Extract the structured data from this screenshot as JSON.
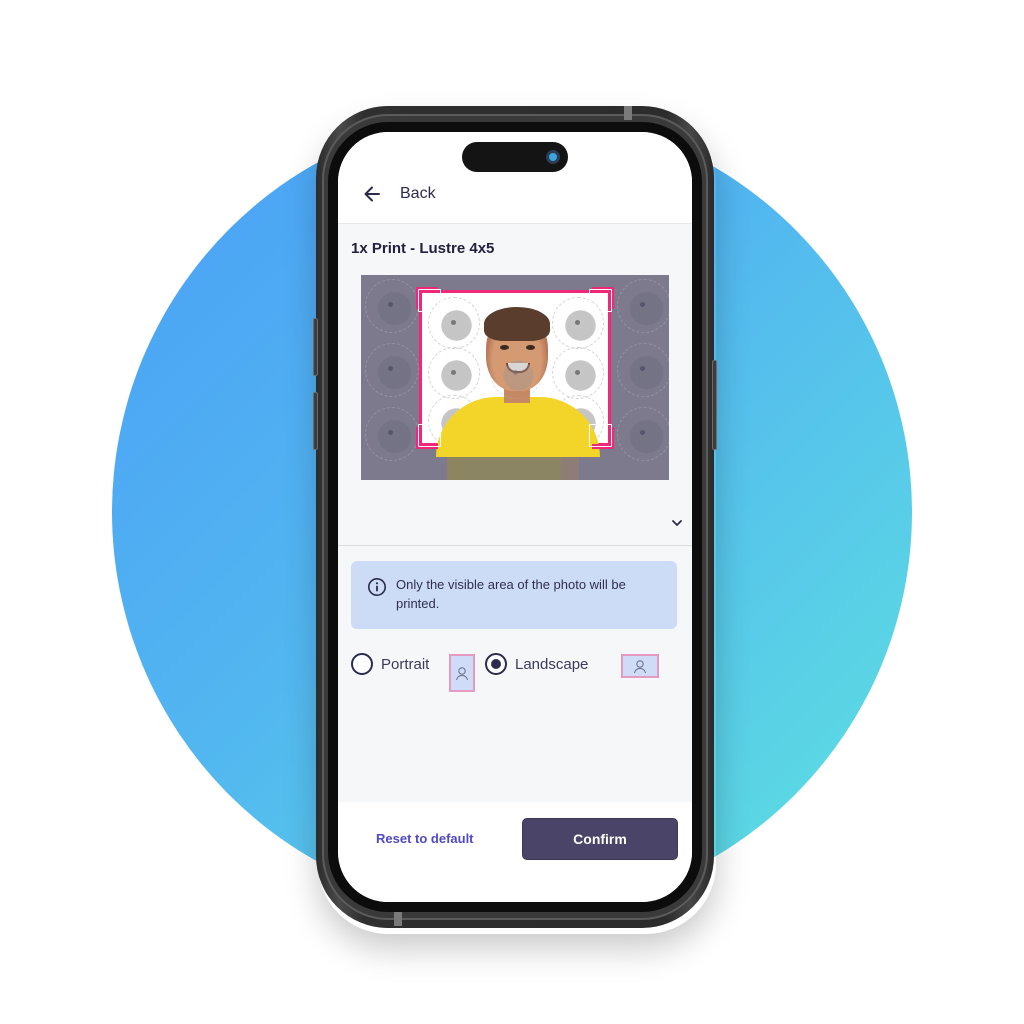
{
  "colors": {
    "background_gradient_start": "#4a9ff7",
    "background_gradient_end": "#5ee2e0",
    "crop_frame": "#f0287a",
    "info_box": "#cddcf6",
    "primary_button": "#4b4469",
    "link": "#5049c4",
    "text_dark": "#21213f"
  },
  "header": {
    "back_icon": "arrow-left-icon",
    "back_label": "Back"
  },
  "product": {
    "title": "1x Print - Lustre 4x5"
  },
  "preview": {
    "expand_icon": "chevron-down-icon",
    "crop_handles": [
      "top-left",
      "top-right",
      "bottom-left",
      "bottom-right"
    ]
  },
  "notice": {
    "icon": "info-icon",
    "text": "Only the visible area of the photo will be printed."
  },
  "orientation": {
    "options": [
      {
        "label": "Portrait",
        "selected": false,
        "icon": "portrait-thumbnail-icon"
      },
      {
        "label": "Landscape",
        "selected": true,
        "icon": "landscape-thumbnail-icon"
      }
    ]
  },
  "footer": {
    "reset_label": "Reset to default",
    "confirm_label": "Confirm"
  }
}
